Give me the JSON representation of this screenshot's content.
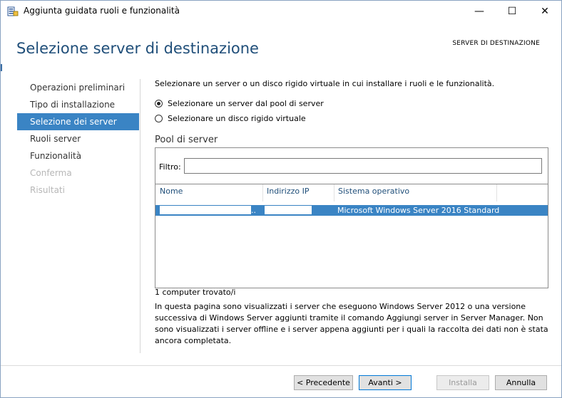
{
  "window": {
    "title": "Aggiunta guidata ruoli e funzionalità",
    "controls": {
      "minimize": "—",
      "maximize": "☐",
      "close": "✕"
    }
  },
  "page": {
    "title": "Selezione server di destinazione",
    "destination_header": "SERVER DI DESTINAZIONE"
  },
  "nav": {
    "items": [
      {
        "label": "Operazioni preliminari",
        "state": "normal"
      },
      {
        "label": "Tipo di installazione",
        "state": "normal"
      },
      {
        "label": "Selezione dei server",
        "state": "active"
      },
      {
        "label": "Ruoli server",
        "state": "normal"
      },
      {
        "label": "Funzionalità",
        "state": "normal"
      },
      {
        "label": "Conferma",
        "state": "disabled"
      },
      {
        "label": "Risultati",
        "state": "disabled"
      }
    ]
  },
  "content": {
    "intro": "Selezionare un server o un disco rigido virtuale in cui installare i ruoli e le funzionalità.",
    "radio_pool": "Selezionare un server dal pool di server",
    "radio_vhd": "Selezionare un disco rigido virtuale",
    "pool_title": "Pool di server",
    "filter_label": "Filtro:",
    "filter_value": "",
    "columns": [
      "Nome",
      "Indirizzo IP",
      "Sistema operativo"
    ],
    "rows": [
      {
        "name": "..",
        "ip": "",
        "os": "Microsoft Windows Server 2016 Standard"
      }
    ],
    "count": "1 computer trovato/i",
    "description": "In questa pagina sono visualizzati i server che eseguono Windows Server 2012 o una versione successiva di Windows Server aggiunti tramite il comando Aggiungi server in Server Manager. Non sono visualizzati i server offline e i server appena aggiunti per i quali la raccolta dei dati non è stata ancora completata."
  },
  "buttons": {
    "previous": "< Precedente",
    "next": "Avanti >",
    "install": "Installa",
    "cancel": "Annulla"
  },
  "colors": {
    "accent": "#3a84c4",
    "title": "#1f4e79"
  }
}
